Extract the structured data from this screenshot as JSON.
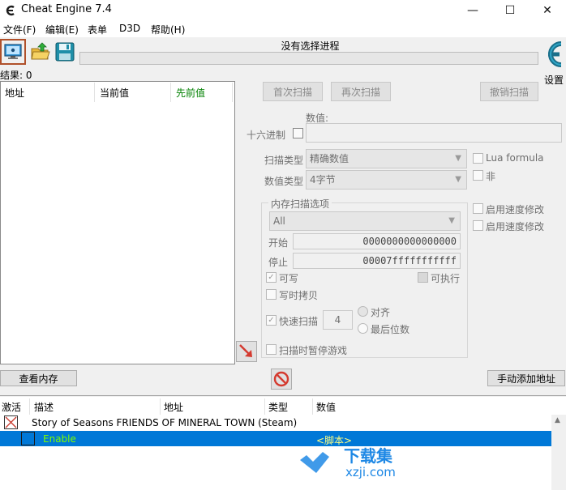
{
  "window": {
    "title": "Cheat Engine 7.4",
    "minimize": "—",
    "maximize": "☐",
    "close": "✕"
  },
  "menu": [
    "文件(F)",
    "编辑(E)",
    "表单",
    "D3D",
    "帮助(H)"
  ],
  "toolbar": {
    "process_label": "没有选择进程",
    "settings_label": "设置"
  },
  "results": {
    "label": "结果: 0",
    "columns": [
      "地址",
      "当前值",
      "先前值"
    ],
    "prev_color": "#008000"
  },
  "scan": {
    "first_scan": "首次扫描",
    "next_scan": "再次扫描",
    "undo_scan": "撤销扫描",
    "value_label": "数值:",
    "hex_label": "十六进制",
    "scan_type_label": "扫描类型",
    "scan_type_value": "精确数值",
    "value_type_label": "数值类型",
    "value_type_value": "4字节",
    "lua_formula": "Lua formula",
    "not_label": "非",
    "mem_options_title": "内存扫描选项",
    "mem_region": "All",
    "start_label": "开始",
    "start_value": "0000000000000000",
    "stop_label": "停止",
    "stop_value": "00007fffffffffff",
    "writable": "可写",
    "executable": "可执行",
    "copy_on_write": "写时拷贝",
    "fast_scan": "快速扫描",
    "fast_scan_value": "4",
    "align": "对齐",
    "last_digits": "最后位数",
    "pause_game": "扫描时暂停游戏",
    "speedhack1": "启用速度修改",
    "speedhack2": "启用速度修改"
  },
  "buttons": {
    "view_memory": "查看内存",
    "add_address": "手动添加地址"
  },
  "address_list": {
    "columns": [
      "激活",
      "描述",
      "地址",
      "类型",
      "数值"
    ],
    "rows": [
      {
        "description": "Story of Seasons FRIENDS OF MINERAL TOWN (Steam)",
        "value": ""
      },
      {
        "description": "Enable",
        "value": "<脚本>"
      }
    ]
  },
  "watermark": {
    "text": "下载集",
    "url": "xzji.com"
  },
  "colors": {
    "selection": "#0078d7",
    "enable_text": "#7cfc00",
    "script_text": "#ffff80"
  }
}
